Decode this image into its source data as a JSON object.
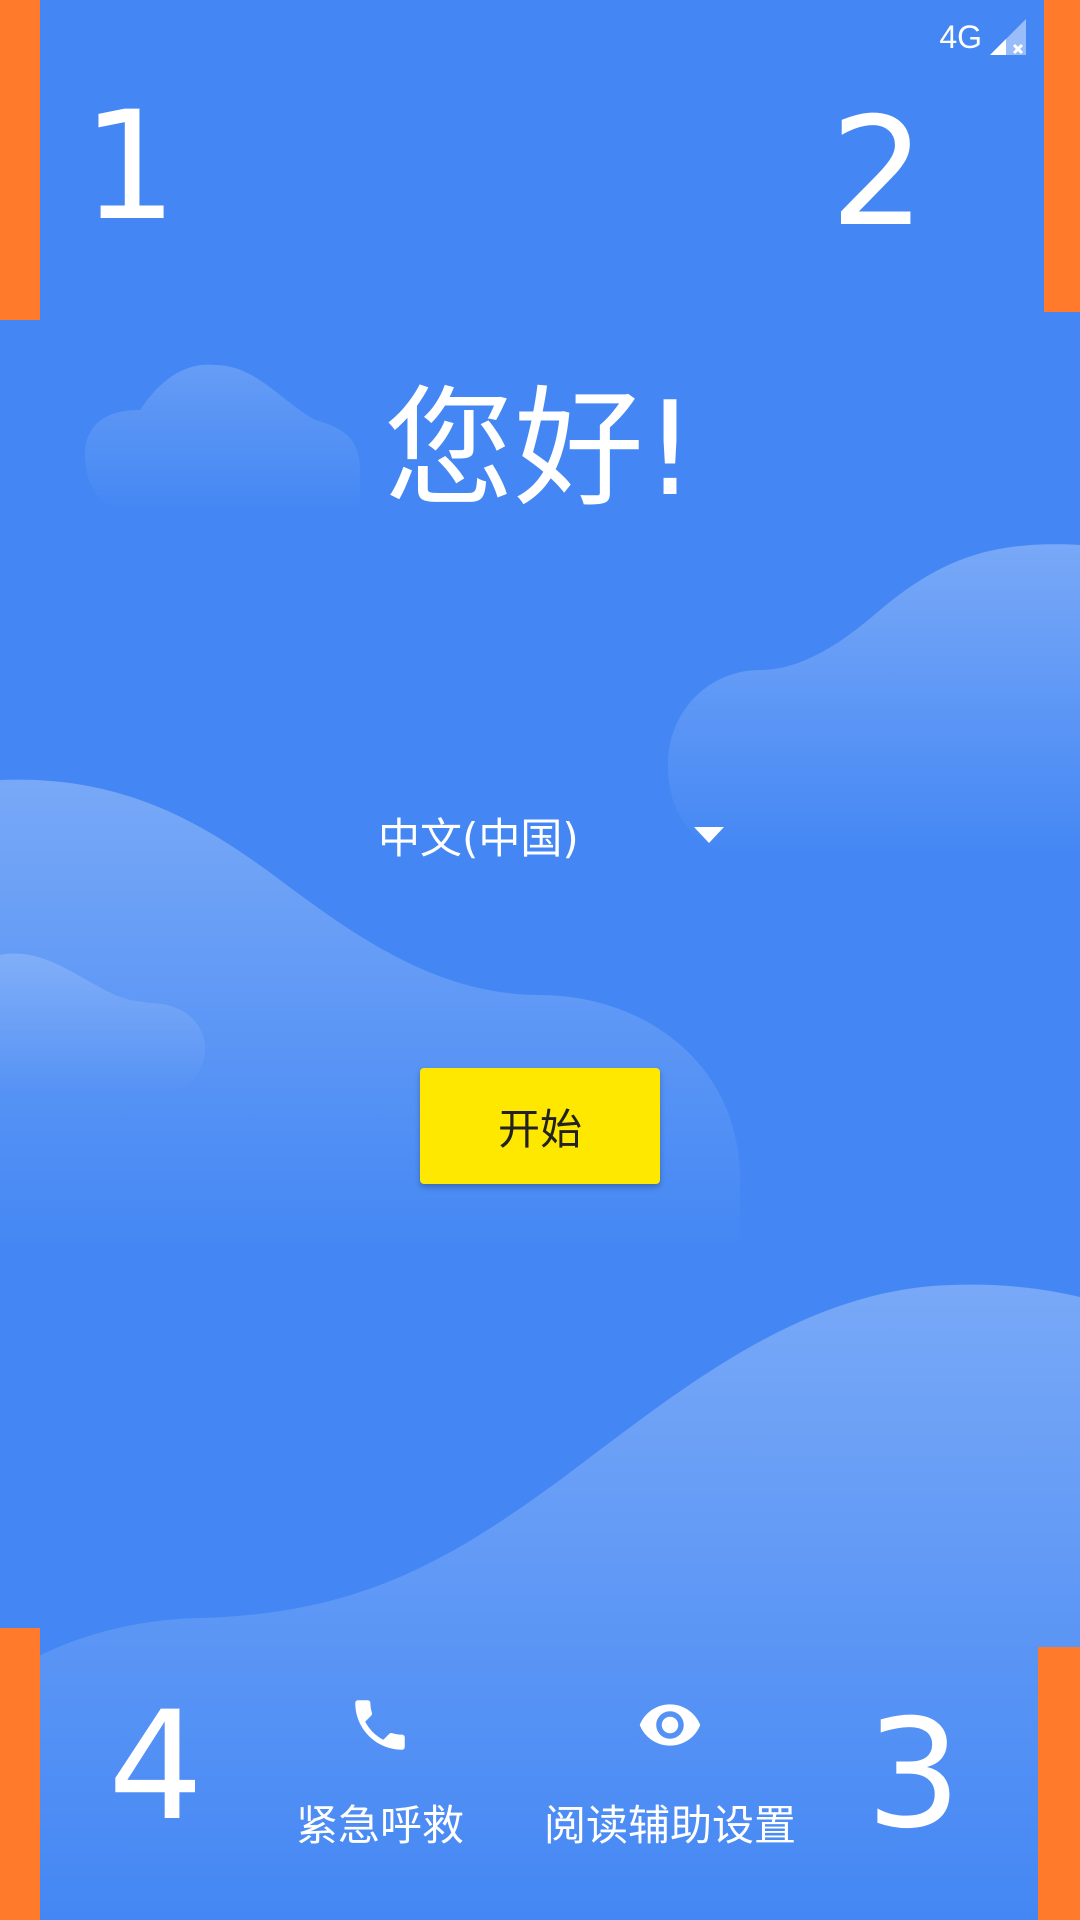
{
  "status_bar": {
    "network": "4G",
    "signal_icon": "signal-no-service-icon",
    "battery_icon": "battery-icon"
  },
  "markers": {
    "top_left": "1",
    "top_right": "2",
    "bottom_right": "3",
    "bottom_left": "4"
  },
  "welcome": {
    "greeting": "您好!",
    "language": "中文(中国)",
    "start_label": "开始"
  },
  "bottom_actions": {
    "emergency_label": "紧急呼救",
    "emergency_icon": "phone-icon",
    "accessibility_label": "阅读辅助设置",
    "accessibility_icon": "eye-icon"
  },
  "colors": {
    "background": "#4487f4",
    "start_button": "#ffe800",
    "marker": "#ff7a2a"
  }
}
